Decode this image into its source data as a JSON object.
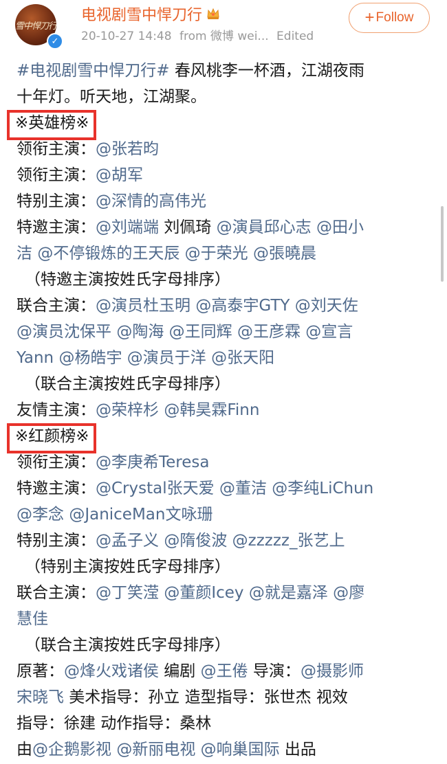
{
  "post": {
    "author": {
      "name": "电视剧雪中悍刀行",
      "avatar_text": "雪中悍刀行"
    },
    "meta": {
      "date": "20-10-27 14:48",
      "source": "from 微博 wei...",
      "edited": "Edited"
    },
    "follow_label": "Follow",
    "content": {
      "intro": [
        [
          {
            "t": "#电视剧雪中悍刀行#",
            "link": true
          },
          {
            "t": " 春风桃李一杯酒，江湖夜雨"
          }
        ],
        [
          {
            "t": "十年灯。听天地，江湖聚。"
          }
        ]
      ],
      "section1_header": "※英雄榜※",
      "section1": [
        [
          {
            "t": "领衔主演："
          },
          {
            "t": "@张若昀",
            "link": true
          }
        ],
        [
          {
            "t": "领衔主演："
          },
          {
            "t": "@胡军",
            "link": true
          }
        ],
        [
          {
            "t": "特别主演："
          },
          {
            "t": "@深情的高伟光",
            "link": true
          }
        ],
        [
          {
            "t": "特邀主演："
          },
          {
            "t": "@刘端端",
            "link": true
          },
          {
            "t": " 刘佩琦 "
          },
          {
            "t": "@演員邱心志",
            "link": true
          },
          {
            "t": " "
          },
          {
            "t": "@田小",
            "link": true
          }
        ],
        [
          {
            "t": "洁",
            "link": true
          },
          {
            "t": " "
          },
          {
            "t": "@不停锻炼的王天辰",
            "link": true
          },
          {
            "t": " "
          },
          {
            "t": "@于荣光",
            "link": true
          },
          {
            "t": " "
          },
          {
            "t": "@張曉晨",
            "link": true
          }
        ],
        [
          {
            "t": "（特邀主演按姓氏字母排序）",
            "indent": true
          }
        ],
        [
          {
            "t": "联合主演："
          },
          {
            "t": "@演员杜玉明",
            "link": true
          },
          {
            "t": " "
          },
          {
            "t": "@高泰宇GTY",
            "link": true
          },
          {
            "t": " "
          },
          {
            "t": "@刘天佐",
            "link": true
          }
        ],
        [
          {
            "t": "@演员沈保平",
            "link": true
          },
          {
            "t": " "
          },
          {
            "t": "@陶海",
            "link": true
          },
          {
            "t": " "
          },
          {
            "t": "@王同辉",
            "link": true
          },
          {
            "t": " "
          },
          {
            "t": "@王彦霖",
            "link": true
          },
          {
            "t": " "
          },
          {
            "t": "@宣言",
            "link": true
          }
        ],
        [
          {
            "t": "Yann",
            "link": true
          },
          {
            "t": "  "
          },
          {
            "t": "@杨皓宇",
            "link": true
          },
          {
            "t": " "
          },
          {
            "t": "@演员于洋",
            "link": true
          },
          {
            "t": " "
          },
          {
            "t": "@张天阳",
            "link": true
          }
        ],
        [
          {
            "t": "（联合主演按姓氏字母排序）",
            "indent": true
          }
        ],
        [
          {
            "t": "友情主演："
          },
          {
            "t": "@荣梓杉",
            "link": true
          },
          {
            "t": " "
          },
          {
            "t": "@韩昊霖Finn",
            "link": true
          }
        ]
      ],
      "section2_header": "※红颜榜※",
      "section2": [
        [
          {
            "t": "领衔主演："
          },
          {
            "t": "@李庚希Teresa",
            "link": true
          }
        ],
        [
          {
            "t": "特邀主演："
          },
          {
            "t": "@Crystal张天爱",
            "link": true
          },
          {
            "t": " "
          },
          {
            "t": "@董洁",
            "link": true
          },
          {
            "t": " "
          },
          {
            "t": "@李纯LiChun",
            "link": true
          }
        ],
        [
          {
            "t": "@李念",
            "link": true
          },
          {
            "t": " "
          },
          {
            "t": "@JaniceMan文咏珊",
            "link": true
          }
        ],
        [
          {
            "t": "特别主演："
          },
          {
            "t": "@孟子义",
            "link": true
          },
          {
            "t": " "
          },
          {
            "t": "@隋俊波",
            "link": true
          },
          {
            "t": " "
          },
          {
            "t": "@zzzzz_张艺上",
            "link": true
          }
        ],
        [
          {
            "t": "（特别主演按姓氏字母排序）",
            "indent": true
          }
        ],
        [
          {
            "t": "联合主演："
          },
          {
            "t": "@丁笑滢",
            "link": true
          },
          {
            "t": " "
          },
          {
            "t": "@董颜Icey",
            "link": true
          },
          {
            "t": " "
          },
          {
            "t": "@就是嘉泽",
            "link": true
          },
          {
            "t": " "
          },
          {
            "t": "@廖",
            "link": true
          }
        ],
        [
          {
            "t": "慧佳",
            "link": true
          }
        ],
        [
          {
            "t": "（联合主演按姓氏字母排序）",
            "indent": true
          }
        ],
        [
          {
            "t": "原著："
          },
          {
            "t": "@烽火戏诸侯",
            "link": true
          },
          {
            "t": " 编剧 "
          },
          {
            "t": "@王倦",
            "link": true
          },
          {
            "t": " 导演："
          },
          {
            "t": "@摄影师",
            "link": true
          }
        ],
        [
          {
            "t": "宋晓飞",
            "link": true
          },
          {
            "t": "  美术指导：孙立  造型指导：张世杰  视效"
          }
        ],
        [
          {
            "t": "指导：徐建  动作指导：桑林"
          }
        ],
        [
          {
            "t": "由"
          },
          {
            "t": "@企鹅影视",
            "link": true
          },
          {
            "t": " "
          },
          {
            "t": "@新丽电视",
            "link": true
          },
          {
            "t": "  "
          },
          {
            "t": "@响巢国际",
            "link": true
          },
          {
            "t": " 出品"
          }
        ]
      ]
    }
  }
}
